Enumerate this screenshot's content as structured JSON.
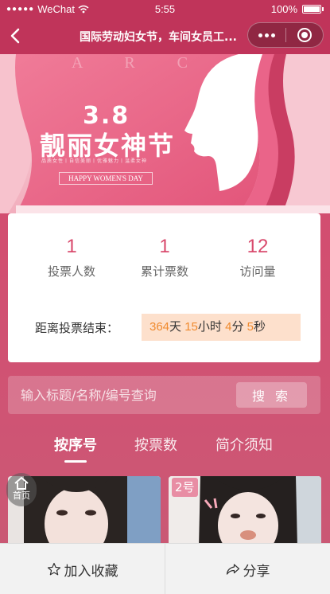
{
  "status_bar": {
    "carrier": "WeChat",
    "time": "5:55",
    "battery": "100%"
  },
  "nav": {
    "title": "国际劳动妇女节，车间女员工..."
  },
  "banner": {
    "watermark": "A R C H",
    "date": "3.8",
    "festival": "靓丽女神节",
    "subline": "品质女性丨自信美丽丨优雅魅力丨温柔女神",
    "english": "HAPPY WOMEN'S DAY"
  },
  "stats": {
    "items": [
      {
        "value": "1",
        "label": "投票人数"
      },
      {
        "value": "1",
        "label": "累计票数"
      },
      {
        "value": "12",
        "label": "访问量"
      }
    ],
    "countdown_label": "距离投票结束：",
    "countdown": {
      "days": "364",
      "days_unit": "天",
      "hours": "15",
      "hours_unit": "小时",
      "minutes": "4",
      "minutes_unit": "分",
      "seconds": "5",
      "seconds_unit": "秒"
    }
  },
  "search": {
    "placeholder": "输入标题/名称/编号查询",
    "button": "搜 索"
  },
  "tabs": [
    {
      "label": "按序号",
      "active": true
    },
    {
      "label": "按票数",
      "active": false
    },
    {
      "label": "简介须知",
      "active": false
    }
  ],
  "cards": [
    {
      "badge": ""
    },
    {
      "badge": "2号"
    }
  ],
  "home_float": {
    "label": "首页"
  },
  "bottom_bar": {
    "favorite": "加入收藏",
    "share": "分享"
  }
}
